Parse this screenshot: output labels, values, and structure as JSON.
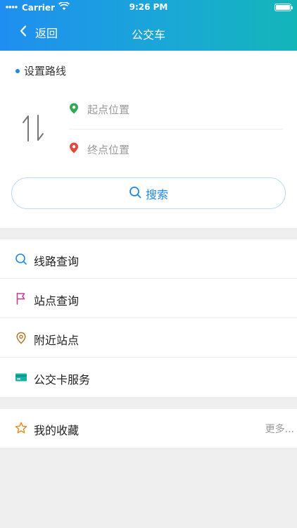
{
  "status_bar": {
    "carrier": "Carrier",
    "time": "9:26 PM"
  },
  "nav": {
    "back_label": "返回",
    "title": "公交车"
  },
  "route": {
    "section_title": "设置路线",
    "start_placeholder": "起点位置",
    "end_placeholder": "终点位置",
    "search_label": "搜索"
  },
  "menu": {
    "items": [
      {
        "label": "线路查询",
        "icon": "search-icon",
        "color": "#1e88e5"
      },
      {
        "label": "站点查询",
        "icon": "flag-icon",
        "color": "#c0439b"
      },
      {
        "label": "附近站点",
        "icon": "location-pin-icon",
        "color": "#b07a2a"
      },
      {
        "label": "公交卡服务",
        "icon": "card-icon",
        "color": "#14b3a3"
      }
    ]
  },
  "favorites": {
    "label": "我的收藏",
    "more_label": "更多...",
    "icon": "star-icon",
    "icon_color": "#e98a1f"
  },
  "colors": {
    "accent": "#1e88e5",
    "header_start": "#1f8ef0",
    "header_end": "#13b6b8",
    "start_pin": "#34a853",
    "end_pin": "#e04a3b"
  }
}
